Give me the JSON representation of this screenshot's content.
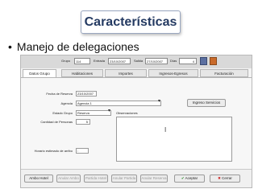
{
  "slide": {
    "title": "Características",
    "bullet": "Manejo de delegaciones"
  },
  "toolbar": {
    "grupo_label": "Grupo",
    "grupo_value": "114",
    "entrada_label": "Entrada",
    "entrada_value": "23/10/2007",
    "salida_label": "Salida",
    "salida_value": "27/10/2007",
    "dias_label": "Días",
    "dias_value": "4"
  },
  "tabs": [
    "Datos Grupo",
    "Habitaciones",
    "Importes",
    "Ingresos-Egresos",
    "Facturación"
  ],
  "form": {
    "fecha_label": "Fecha de Reserva",
    "fecha_value": "23/10/2007",
    "agencia_label": "Agencia",
    "agencia_value": "Agencia 1",
    "estado_label": "Estado Grupo",
    "estado_value": "Reserva",
    "cantidad_label": "Cantidad de Personas",
    "cantidad_value": "5",
    "observaciones_label": "Observaciones",
    "ingreso_servicios": "Ingreso Servicios",
    "horario_label": "Horario estimado de arribo",
    "horario_value": "  :  "
  },
  "buttons": {
    "ambo_hotel": "Ambo Hotel",
    "anular_ambo": "Anular Ambo",
    "partida_hotel": "Partida Hotel",
    "anular_partida": "Anular Partida",
    "anular_reserva": "Anular Reserva",
    "aceptar": "Aceptar",
    "cerrar": "Cerrar"
  },
  "colors": {
    "title_text": "#243a62",
    "accent_tab": "#ffffff"
  }
}
